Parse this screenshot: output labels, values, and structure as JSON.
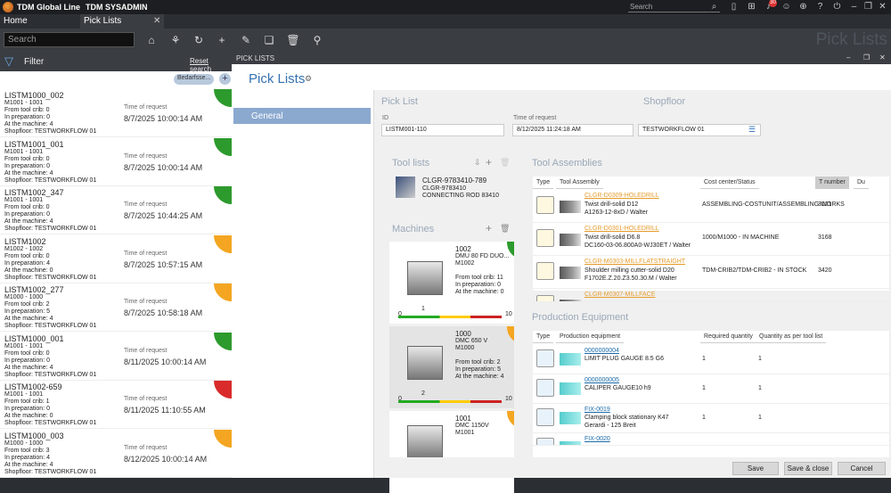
{
  "titlebar": {
    "app": "TDM Global Line",
    "user": "TDM SYSADMIN",
    "search_placeholder": "Search",
    "notif_count": "30"
  },
  "tabs": [
    "Home",
    "Pick Lists"
  ],
  "toolbar": {
    "search_placeholder": "Search",
    "big_title": "Pick Lists"
  },
  "filter": {
    "label": "Filter",
    "reset": "Reset search",
    "chip": "Bedarfsse..."
  },
  "list": [
    {
      "name": "LISTM1000_002",
      "lines": [
        "M1001 - 1001",
        "From tool crib: 0",
        "In preparation: 0",
        "At the machine: 4",
        "Shopfloor: TESTWORKFLOW 01"
      ],
      "time_label": "Time of request",
      "time": "8/7/2025 10:00:14 AM",
      "color": "#2d9a2d"
    },
    {
      "name": "LISTM1001_001",
      "lines": [
        "M1001 - 1001",
        "From tool crib: 0",
        "In preparation: 0",
        "At the machine: 4",
        "Shopfloor: TESTWORKFLOW 01"
      ],
      "time_label": "Time of request",
      "time": "8/7/2025 10:00:14 AM",
      "color": "#2d9a2d"
    },
    {
      "name": "LISTM1002_347",
      "lines": [
        "M1001 - 1001",
        "From tool crib: 0",
        "In preparation: 0",
        "At the machine: 4",
        "Shopfloor: TESTWORKFLOW 01"
      ],
      "time_label": "Time of request",
      "time": "8/7/2025 10:44:25 AM",
      "color": "#2d9a2d"
    },
    {
      "name": "LISTM1002",
      "lines": [
        "M1002 - 1002",
        "From tool crib: 0",
        "In preparation: 4",
        "At the machine: 0",
        "Shopfloor: TESTWORKFLOW 01"
      ],
      "time_label": "Time of request",
      "time": "8/7/2025 10:57:15 AM",
      "color": "#f4a622"
    },
    {
      "name": "LISTM1002_277",
      "lines": [
        "M1000 - 1000",
        "From tool crib: 2",
        "In preparation: 5",
        "At the machine: 4",
        "Shopfloor: TESTWORKFLOW 01"
      ],
      "time_label": "Time of request",
      "time": "8/7/2025 10:58:18 AM",
      "color": "#f4a622"
    },
    {
      "name": "LISTM1000_001",
      "lines": [
        "M1001 - 1001",
        "From tool crib: 0",
        "In preparation: 0",
        "At the machine: 4",
        "Shopfloor: TESTWORKFLOW 01"
      ],
      "time_label": "Time of request",
      "time": "8/11/2025 10:00:14 AM",
      "color": "#2d9a2d"
    },
    {
      "name": "LISTM1002-659",
      "lines": [
        "M1001 - 1001",
        "From tool crib: 1",
        "In preparation: 0",
        "At the machine: 0",
        "Shopfloor: TESTWORKFLOW 01"
      ],
      "time_label": "Time of request",
      "time": "8/11/2025 11:10:55 AM",
      "color": "#d92b2b"
    },
    {
      "name": "LISTM1000_003",
      "lines": [
        "M1000 - 1000",
        "From tool crib: 3",
        "In preparation: 4",
        "At the machine: 4",
        "Shopfloor: TESTWORKFLOW 01"
      ],
      "time_label": "Time of request",
      "time": "8/12/2025 10:00:14 AM",
      "color": "#f4a622"
    }
  ],
  "pl": {
    "window_title": "PICK LISTS",
    "title": "Pick Lists",
    "nav": "General",
    "pick_list": "Pick List",
    "shopfloor": "Shopfloor",
    "id_label": "ID",
    "id": "LISTM001-110",
    "time_label": "Time of request",
    "time": "8/12/2025 11:24:18 AM",
    "shopfloor_val": "TESTWORKFLOW 01",
    "tool_lists": "Tool lists",
    "tl_id": "CLGR-9783410-789",
    "tl_code": "CLGR-9783410",
    "tl_desc": "CONNECTING ROD 83410",
    "machines_label": "Machines",
    "machines": [
      {
        "id": "1002",
        "name": "DMU 80 FD DUO...",
        "code": "M1002",
        "crib": "From tool crib: 11",
        "prep": "In preparation: 0",
        "at": "At the machine: 0",
        "min": "0",
        "max": "10",
        "mark": "1",
        "color": "#2d9a2d"
      },
      {
        "id": "1000",
        "name": "DMC 650 V",
        "code": "M1000",
        "crib": "From tool crib: 2",
        "prep": "In preparation: 5",
        "at": "At the machine: 4",
        "min": "0",
        "max": "10",
        "mark": "2",
        "color": "#f4a622"
      },
      {
        "id": "1001",
        "name": "DMC 1150V",
        "code": "M1001",
        "crib": "",
        "prep": "",
        "at": "",
        "min": "",
        "max": "",
        "mark": "",
        "color": "#f4a622"
      }
    ],
    "ta_title": "Tool Assemblies",
    "ta_cols": [
      "Type",
      "Tool Assembly",
      "Cost center/Status",
      "T number",
      "Du"
    ],
    "ta_rows": [
      {
        "link": "CLGR-D0309-HOLEDRILL",
        "l1": "Twist drill-solid D12",
        "l2": "A1263-12-8xD / Walter",
        "status": "ASSEMBLING-COSTUNIT/ASSEMBLING-WORKS",
        "t": "3121"
      },
      {
        "link": "CLGR-D0301-HOLEDRILL",
        "l1": "Twist drill-solid D6.8",
        "l2": "DC160-03-06.800A0-WJ30ET / Walter",
        "status": "1000/M1000 - IN MACHINE",
        "t": "3168"
      },
      {
        "link": "CLGR-M0303-MILLFLATSTRAIGHT",
        "l1": "Shoulder milling cutter-solid D20",
        "l2": "F1702E.Z.20.Z3.50.30.M / Walter",
        "status": "TDM-CRIB2/TDM-CRIB2 - IN STOCK",
        "t": "3420"
      },
      {
        "link": "CLGR-M0307-MILLFACE",
        "l1": "",
        "l2": "",
        "status": "",
        "t": ""
      }
    ],
    "pe_title": "Production Equipment",
    "pe_cols": [
      "Type",
      "Production equipment",
      "Required quantity",
      "Quantity as per tool list"
    ],
    "pe_rows": [
      {
        "link": "0000000004",
        "l1": "LIMIT PLUG GAUGE 8.5 G6",
        "l2": "",
        "req": "1",
        "qty": "1"
      },
      {
        "link": "0000000005",
        "l1": "CALIPER GAUGE10 h9",
        "l2": "",
        "req": "1",
        "qty": "1"
      },
      {
        "link": "FIX-0019",
        "l1": "Clamping block stationary K47",
        "l2": "Gerardi - 125 Breit",
        "req": "1",
        "qty": "1"
      },
      {
        "link": "FIX-0020",
        "l1": "",
        "l2": "",
        "req": "",
        "qty": ""
      }
    ],
    "save": "Save",
    "save_close": "Save & close",
    "cancel": "Cancel"
  }
}
